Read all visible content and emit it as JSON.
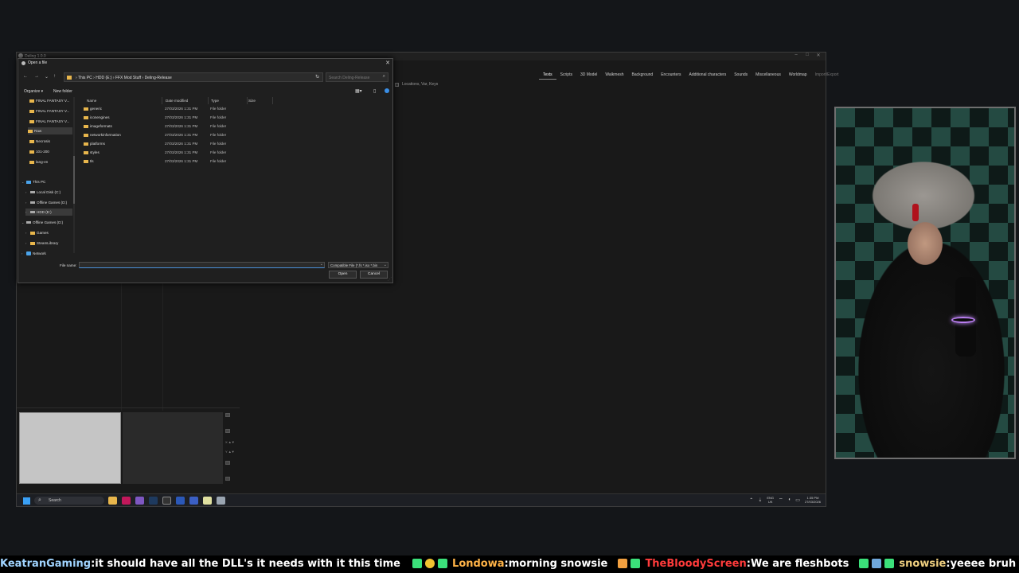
{
  "app": {
    "title": "Deling 1.0.0",
    "tabs": [
      {
        "label": "Texts",
        "active": true
      },
      {
        "label": "Scripts"
      },
      {
        "label": "3D Model"
      },
      {
        "label": "Walkmesh"
      },
      {
        "label": "Background"
      },
      {
        "label": "Encounters"
      },
      {
        "label": "Additional characters"
      },
      {
        "label": "Sounds"
      },
      {
        "label": "Miscellaneous"
      },
      {
        "label": "Worldmap"
      },
      {
        "label": "Import/Export"
      }
    ],
    "locations_line": "Locations,  Var,  Keys"
  },
  "dialog": {
    "title": "Open a file",
    "address": {
      "segments": [
        "This PC",
        "HDD (E:)",
        "FFX Mod Stuff",
        "Deling-Release"
      ],
      "separator": "›"
    },
    "search_placeholder": "Search Deling-Release",
    "organize_label": "Organize ▾",
    "new_folder_label": "New folder",
    "columns": {
      "name": "Name",
      "date": "Date modified",
      "type": "Type",
      "size": "Size"
    },
    "files": [
      {
        "name": "generic",
        "date": "27/03/2026 1:31 PM",
        "type": "File folder"
      },
      {
        "name": "iconengines",
        "date": "27/03/2026 1:31 PM",
        "type": "File folder"
      },
      {
        "name": "imageformats",
        "date": "27/03/2026 1:31 PM",
        "type": "File folder"
      },
      {
        "name": "networkinformation",
        "date": "27/03/2026 1:31 PM",
        "type": "File folder"
      },
      {
        "name": "platforms",
        "date": "27/03/2026 1:31 PM",
        "type": "File folder"
      },
      {
        "name": "styles",
        "date": "27/03/2026 1:31 PM",
        "type": "File folder"
      },
      {
        "name": "tls",
        "date": "27/03/2026 1:31 PM",
        "type": "File folder"
      }
    ],
    "nav_pane": {
      "quick": [
        "FINAL FANTASY V...",
        "FINAL FANTASY V...",
        "FINAL FANTASY V...",
        "Raw",
        "Necrosis",
        "101-200",
        "lang-en"
      ],
      "this_pc": "This PC",
      "drives": [
        "Local Disk (C:)",
        "Offline Games (D:)",
        "HDD (E:)"
      ],
      "offline_games": "Offline Games (D:)",
      "offline_children": [
        "Games",
        "SteamLibrary"
      ],
      "network": "Network"
    },
    "file_name_label": "File name:",
    "file_name_value": "",
    "file_type_value": "Compatible File (*.fs *.iso *.bin",
    "open_label": "Open",
    "cancel_label": "Cancel"
  },
  "taskbar": {
    "search_label": "Search",
    "lang_top": "ENG",
    "lang_bottom": "UK",
    "time": "1:35 PM",
    "date": "27/03/2026"
  },
  "ticker": [
    {
      "user": "KeatranGaming",
      "user_color": "#a0d4ff",
      "text": "it should have all the DLL's it needs with it this time"
    },
    {
      "user": "Londowa",
      "user_color": "#ffb347",
      "text": "morning snowsie"
    },
    {
      "user": "TheBloodyScreen",
      "user_color": "#ff3b3b",
      "text": "We are fleshbots"
    },
    {
      "user": "snowsie",
      "user_color": "#f0d080",
      "text": "yeeee bruh"
    }
  ],
  "colors": {
    "accent": "#4a90d9",
    "folder": "#e8b64c",
    "ticker_badge": "#3be07a"
  }
}
